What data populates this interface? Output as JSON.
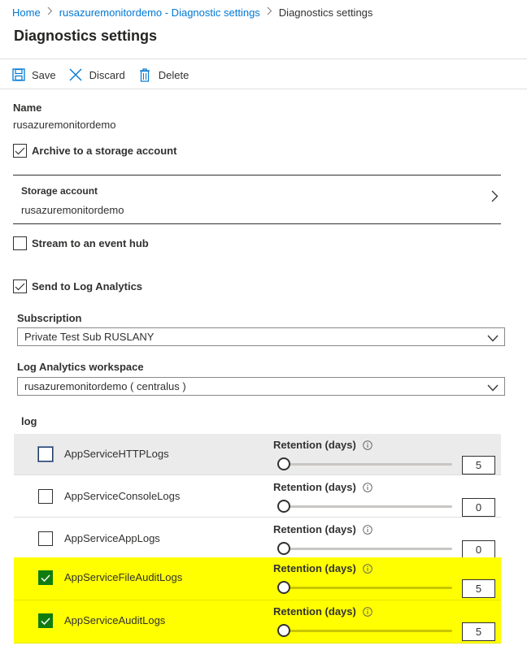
{
  "breadcrumb": {
    "items": [
      "Home",
      "rusazuremonitordemo - Diagnostic settings"
    ],
    "current": "Diagnostics settings"
  },
  "page_title": "Diagnostics settings",
  "toolbar": {
    "save_label": "Save",
    "discard_label": "Discard",
    "delete_label": "Delete"
  },
  "name": {
    "label": "Name",
    "value": "rusazuremonitordemo"
  },
  "archive": {
    "label": "Archive to a storage account",
    "checked": true
  },
  "storage_account": {
    "label": "Storage account",
    "value": "rusazuremonitordemo"
  },
  "event_hub": {
    "label": "Stream to an event hub",
    "checked": false
  },
  "log_analytics": {
    "label": "Send to Log Analytics",
    "checked": true
  },
  "subscription": {
    "label": "Subscription",
    "value": "Private Test Sub RUSLANY"
  },
  "workspace": {
    "label": "Log Analytics workspace",
    "value": "rusazuremonitordemo ( centralus )"
  },
  "log_section": {
    "heading": "log",
    "retention_label": "Retention (days)",
    "rows": [
      {
        "name": "AppServiceHTTPLogs",
        "checked": false,
        "retention": "5"
      },
      {
        "name": "AppServiceConsoleLogs",
        "checked": false,
        "retention": "0"
      },
      {
        "name": "AppServiceAppLogs",
        "checked": false,
        "retention": "0"
      },
      {
        "name": "AppServiceFileAuditLogs",
        "checked": true,
        "retention": "5"
      },
      {
        "name": "AppServiceAuditLogs",
        "checked": true,
        "retention": "5"
      }
    ]
  },
  "colors": {
    "link": "#0078d4",
    "highlight": "#ffff00",
    "checked_green": "#107c10"
  },
  "icons": {
    "save": "save-icon",
    "discard": "close-icon",
    "delete": "trash-icon",
    "check": "checkmark-icon",
    "chevron_right": "chevron-right-icon",
    "chevron_down": "chevron-down-icon",
    "info": "info-icon"
  }
}
